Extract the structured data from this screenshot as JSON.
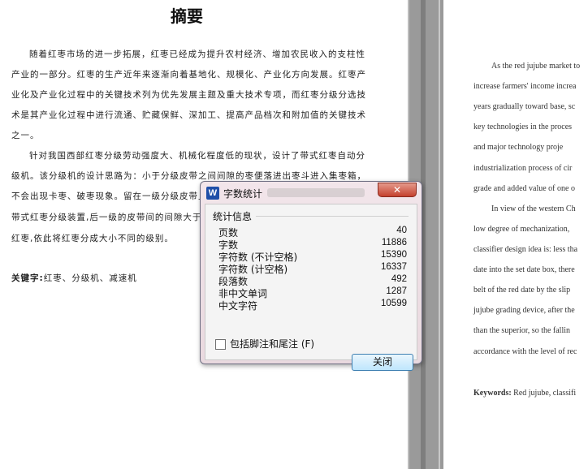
{
  "left_page": {
    "title": "摘要",
    "lines": [
      "随着红枣市场的进一步拓展，红枣已经成为提升农村经济、增加农民收入的支柱性",
      "产业的一部分。红枣的生产近年来逐渐向着基地化、规模化、产业化方向发展。红枣产",
      "业化及产业化过程中的关键技术列为优先发展主题及重大技术专项，而红枣分级分选技",
      "术是其产业化过程中进行流通、贮藏保鲜、深加工、提高产品档次和附加值的关键技术",
      "之一。",
      "针对我国西部红枣分级劳动强度大、机械化程度低的现状，设计了带式红枣自动分",
      "级机。该分级机的设计思路为：小于分级皮带之间间隙的枣便落进出枣斗进入集枣箱，",
      "不会出现卡枣、破枣现象。留在一级分级皮带上",
      "带式红枣分级装置,后一级的皮带间的间隙大于上",
      "红枣,依此将红枣分成大小不同的级别。"
    ],
    "keywords_label": "关键字:",
    "keywords": "红枣、分级机、减速机"
  },
  "right_page": {
    "lines": [
      "As the red jujube market to",
      "increase farmers' income increa",
      "years gradually toward base, sc",
      "key technologies  in  the  proces",
      "and  major  technology  proje",
      "industrialization  process  of  cir",
      "grade and added value of one o",
      "In view of the western Ch",
      "low  degree  of  mechanization,",
      "classifier design idea is: less tha",
      "date into the set date box, there",
      "belt of the red date by the slip",
      "jujube grading device, after the",
      "than  the  superior,  so  the  fallin",
      "accordance with the level of rec"
    ],
    "keywords_label": "Keywords:",
    "keywords": "Red jujube, classifi"
  },
  "dialog": {
    "icon_letter": "W",
    "icon": "wps-writer-icon",
    "title": "字数统计",
    "close_x": "✕",
    "group_label": "统计信息",
    "stats": [
      {
        "label": "页数",
        "value": "40"
      },
      {
        "label": "字数",
        "value": "11886"
      },
      {
        "label": "字符数 (不计空格)",
        "value": "15390"
      },
      {
        "label": "字符数 (计空格)",
        "value": "16337"
      },
      {
        "label": "段落数",
        "value": "492"
      },
      {
        "label": "非中文单词",
        "value": "1287"
      },
      {
        "label": "中文字符",
        "value": "10599"
      }
    ],
    "checkbox_label": "包括脚注和尾注 (F)",
    "checkbox_checked": false,
    "close_button": "关闭"
  }
}
